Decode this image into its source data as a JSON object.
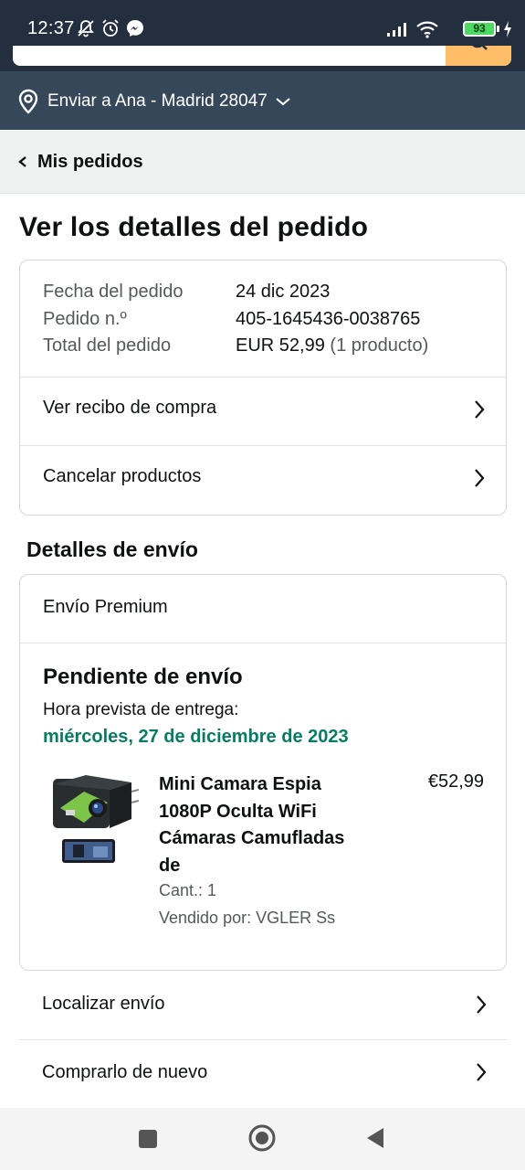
{
  "status_bar": {
    "time": "12:37",
    "battery": "93",
    "icons": [
      "notifications-off-icon",
      "alarm-icon",
      "messenger-icon",
      "signal-icon",
      "wifi-icon",
      "battery-icon",
      "charging-icon"
    ]
  },
  "location": {
    "text": "Enviar a Ana - Madrid 28047",
    "icon": "location-pin-icon"
  },
  "breadcrumb": {
    "label": "Mis pedidos"
  },
  "page": {
    "title": "Ver los detalles del pedido"
  },
  "order_summary": {
    "date_label": "Fecha del pedido",
    "date_value": "24 dic 2023",
    "number_label": "Pedido n.º",
    "number_value": "405-1645436-0038765",
    "total_label": "Total del pedido",
    "total_value": "EUR 52,99",
    "total_items": "(1 producto)",
    "actions": [
      {
        "label": "Ver recibo de compra"
      },
      {
        "label": "Cancelar productos"
      }
    ]
  },
  "shipping": {
    "section_title": "Detalles de envío",
    "method": "Envío Premium",
    "status": "Pendiente de envío",
    "eta_label": "Hora prevista de entrega:",
    "eta_date": "miércoles, 27 de diciembre de 2023",
    "product": {
      "title": "Mini Camara Espia 1080P Oculta WiFi Cámaras Camufladas de",
      "price": "€52,99",
      "quantity": "Cant.: 1",
      "seller": "Vendido por: VGLER Ss"
    }
  },
  "actions": [
    {
      "label": "Localizar envío"
    },
    {
      "label": "Comprarlo de nuevo"
    }
  ],
  "colors": {
    "header_dark": "#232f3e",
    "location_bar": "#37475a",
    "search_button": "#febd69",
    "eta_green": "#067d62",
    "breadcrumb_bg": "#f0f2f2"
  }
}
